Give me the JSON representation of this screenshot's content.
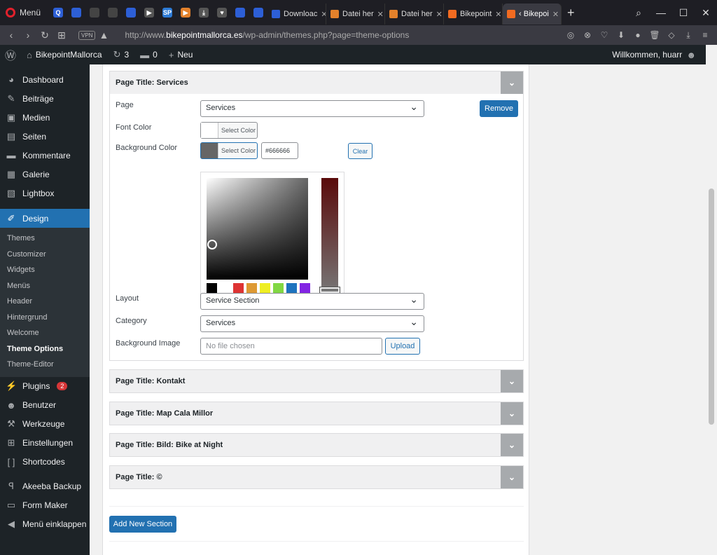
{
  "browser": {
    "menu_label": "Menü",
    "tabs": [
      {
        "label": "Downloac",
        "color": "#2d5fd6"
      },
      {
        "label": "Datei her",
        "color": "#e3812b"
      },
      {
        "label": "Datei her",
        "color": "#e3812b"
      },
      {
        "label": "Bikepoint",
        "color": "#f26b21"
      },
      {
        "label": "‹ Bikepoi",
        "color": "#f26b21"
      }
    ],
    "icon_tabs": [
      "Q",
      "",
      "",
      "",
      "",
      "▶",
      "SP",
      "▶",
      "⤓",
      "♥",
      "",
      ""
    ],
    "url_domain": "http://www.",
    "url_host": "bikepointmallorca.es",
    "url_path": "/wp-admin/themes.php?page=theme-options",
    "vpn_label": "VPN"
  },
  "adminbar": {
    "site_name": "BikepointMallorca",
    "updates": "3",
    "comments": "0",
    "new_label": "Neu",
    "howdy": "Willkommen, huarr"
  },
  "sidebar": {
    "items_top": [
      {
        "label": "Dashboard",
        "icon": "dashboard-icon",
        "glyph": "◕"
      },
      {
        "label": "Beiträge",
        "icon": "pin-icon",
        "glyph": "✎"
      },
      {
        "label": "Medien",
        "icon": "media-icon",
        "glyph": "▣"
      },
      {
        "label": "Seiten",
        "icon": "page-icon",
        "glyph": "▤"
      },
      {
        "label": "Kommentare",
        "icon": "comment-icon",
        "glyph": "▬"
      },
      {
        "label": "Galerie",
        "icon": "gallery-icon",
        "glyph": "▦"
      },
      {
        "label": "Lightbox",
        "icon": "lightbox-icon",
        "glyph": "▧"
      }
    ],
    "design_label": "Design",
    "design_sub": [
      "Themes",
      "Customizer",
      "Widgets",
      "Menüs",
      "Header",
      "Hintergrund",
      "Welcome",
      "Theme Options",
      "Theme-Editor"
    ],
    "items_bottom": [
      {
        "label": "Plugins",
        "icon": "plugin-icon",
        "glyph": "⚡",
        "badge": "2"
      },
      {
        "label": "Benutzer",
        "icon": "user-icon",
        "glyph": "☻"
      },
      {
        "label": "Werkzeuge",
        "icon": "wrench-icon",
        "glyph": "⚒"
      },
      {
        "label": "Einstellungen",
        "icon": "settings-icon",
        "glyph": "⊞"
      },
      {
        "label": "Shortcodes",
        "icon": "shortcode-icon",
        "glyph": "[ ]"
      }
    ],
    "items_extra": [
      {
        "label": "Akeeba Backup",
        "icon": "akeeba-icon",
        "glyph": "ꟼ"
      },
      {
        "label": "Form Maker",
        "icon": "form-icon",
        "glyph": "▭"
      },
      {
        "label": "Menü einklappen",
        "icon": "collapse-icon",
        "glyph": "◀"
      }
    ]
  },
  "services": {
    "title": "Page Title: Services",
    "page_label": "Page",
    "page_value": "Services",
    "remove_label": "Remove",
    "font_color_label": "Font Color",
    "select_color_label": "Select Color",
    "bg_color_label": "Background Color",
    "bg_hex": "#666666",
    "clear_label": "Clear",
    "layout_label": "Layout",
    "layout_value": "Service Section",
    "category_label": "Category",
    "category_value": "Services",
    "bg_image_label": "Background Image",
    "file_placeholder": "No file chosen",
    "upload_label": "Upload",
    "palette": [
      "#000000",
      "#ffffff",
      "#dd3333",
      "#dd9933",
      "#eeee22",
      "#81d742",
      "#1e73be",
      "#8224e3"
    ]
  },
  "collapsed_sections": [
    "Page Title: Kontakt",
    "Page Title: Map Cala Millor",
    "Page Title: Bild: Bike at Night",
    "Page Title: ©"
  ],
  "add_section_label": "Add New Section"
}
